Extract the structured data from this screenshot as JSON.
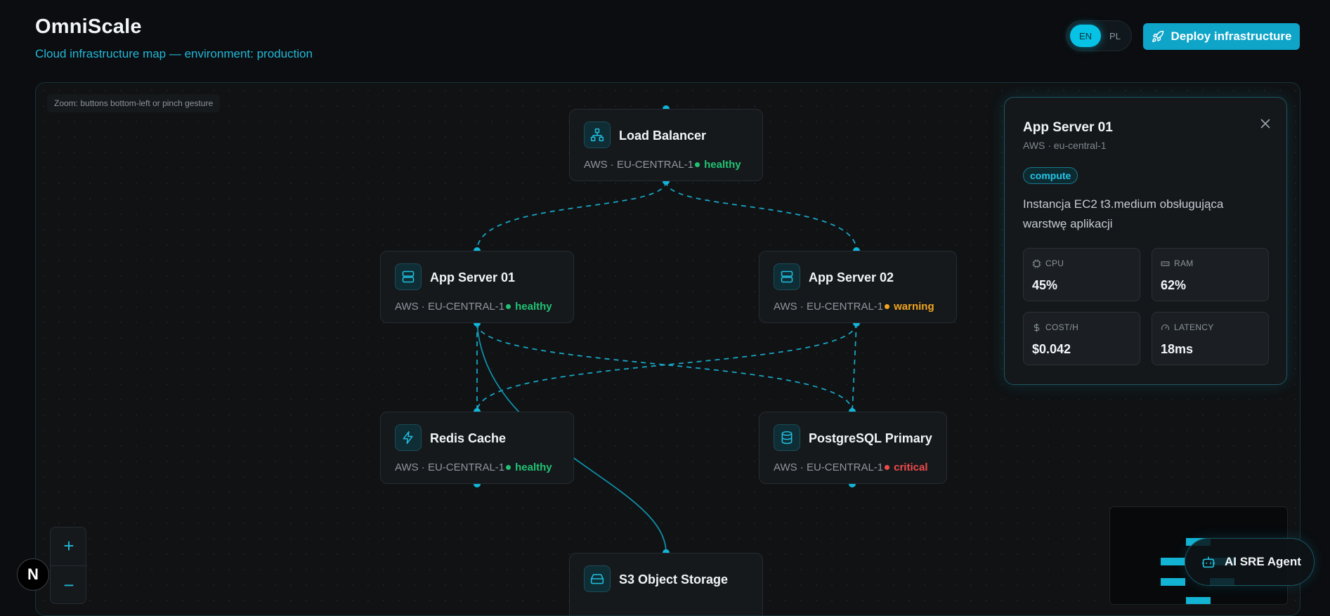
{
  "header": {
    "title": "OmniScale",
    "subtitle": "Cloud infrastructure map — environment: production"
  },
  "lang": {
    "en": "EN",
    "pl": "PL",
    "active": "EN"
  },
  "deploy_label": "Deploy infrastructure",
  "canvas": {
    "zoom_hint": "Zoom: buttons bottom-left or pinch gesture"
  },
  "nodes": {
    "lb": {
      "name": "Load Balancer",
      "meta": "AWS · EU-CENTRAL-1",
      "status": "healthy"
    },
    "app1": {
      "name": "App Server 01",
      "meta": "AWS · EU-CENTRAL-1",
      "status": "healthy"
    },
    "app2": {
      "name": "App Server 02",
      "meta": "AWS · EU-CENTRAL-1",
      "status": "warning"
    },
    "redis": {
      "name": "Redis Cache",
      "meta": "AWS · EU-CENTRAL-1",
      "status": "healthy"
    },
    "pg": {
      "name": "PostgreSQL Primary",
      "meta": "AWS · EU-CENTRAL-1",
      "status": "critical"
    },
    "s3": {
      "name": "S3 Object Storage"
    }
  },
  "detail": {
    "title": "App Server 01",
    "subtitle": "AWS · eu-central-1",
    "tag": "compute",
    "description": "Instancja EC2 t3.medium obsługująca warstwę aplikacji",
    "metrics": {
      "cpu": {
        "label": "CPU",
        "value": "45%"
      },
      "ram": {
        "label": "RAM",
        "value": "62%"
      },
      "cost": {
        "label": "COST/H",
        "value": "$0.042"
      },
      "latency": {
        "label": "LATENCY",
        "value": "18ms"
      }
    }
  },
  "zoom": {
    "in": "+",
    "out": "−"
  },
  "next_badge": "N",
  "ai_agent_label": "AI SRE Agent",
  "colors": {
    "accent": "#0ea5c9",
    "healthy": "#20c374",
    "warning": "#f0a51e",
    "critical": "#ef4b4b"
  }
}
